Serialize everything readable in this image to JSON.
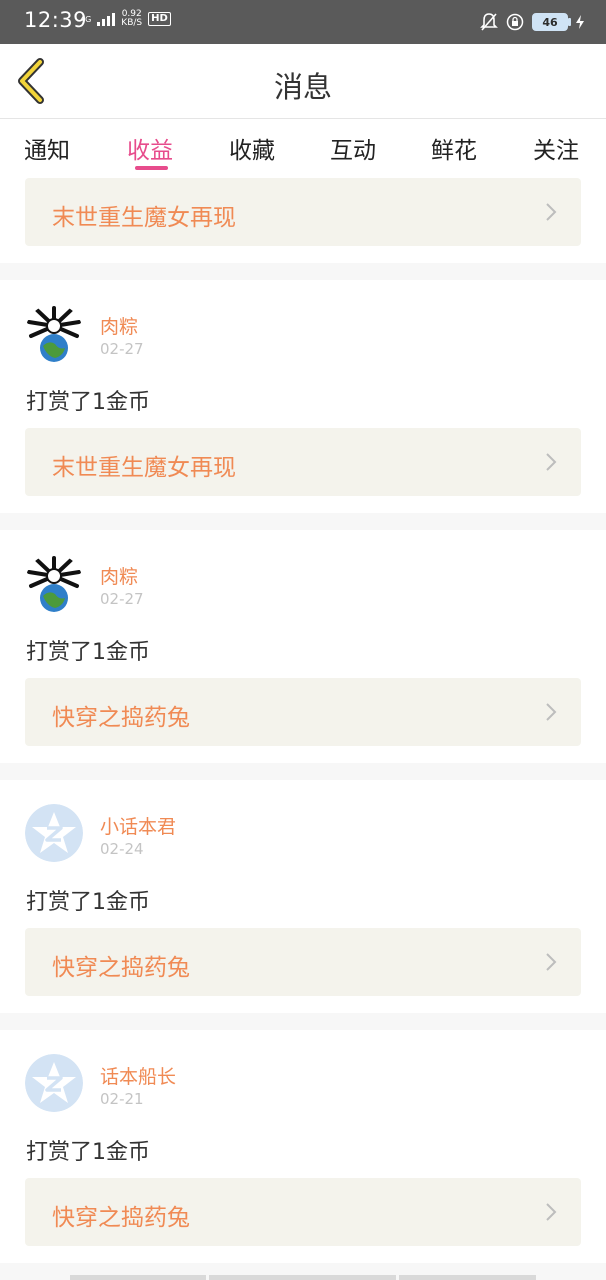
{
  "status_bar": {
    "time": "12:39",
    "signal_small": "4G",
    "net_speed_value": "0.92",
    "net_speed_unit": "KB/S",
    "hd": "HD",
    "battery": "46"
  },
  "header": {
    "title": "消息"
  },
  "tabs": [
    {
      "label": "通知"
    },
    {
      "label": "收益"
    },
    {
      "label": "收藏"
    },
    {
      "label": "互动"
    },
    {
      "label": "鲜花"
    },
    {
      "label": "关注"
    }
  ],
  "active_tab": "收益",
  "colors": {
    "accent": "#e74c8c",
    "orange": "#f08a54"
  },
  "partial_item": {
    "book": "末世重生魔女再现"
  },
  "items": [
    {
      "user": "肉粽",
      "date": "02-27",
      "action": "打赏了1金币",
      "book": "末世重生魔女再现",
      "avatar": "spider-globe-avatar"
    },
    {
      "user": "肉粽",
      "date": "02-27",
      "action": "打赏了1金币",
      "book": "快穿之捣药兔",
      "avatar": "spider-globe-avatar"
    },
    {
      "user": "小话本君",
      "date": "02-24",
      "action": "打赏了1金币",
      "book": "快穿之捣药兔",
      "avatar": "default-z-avatar"
    },
    {
      "user": "话本船长",
      "date": "02-21",
      "action": "打赏了1金币",
      "book": "快穿之捣药兔",
      "avatar": "default-z-avatar"
    }
  ]
}
